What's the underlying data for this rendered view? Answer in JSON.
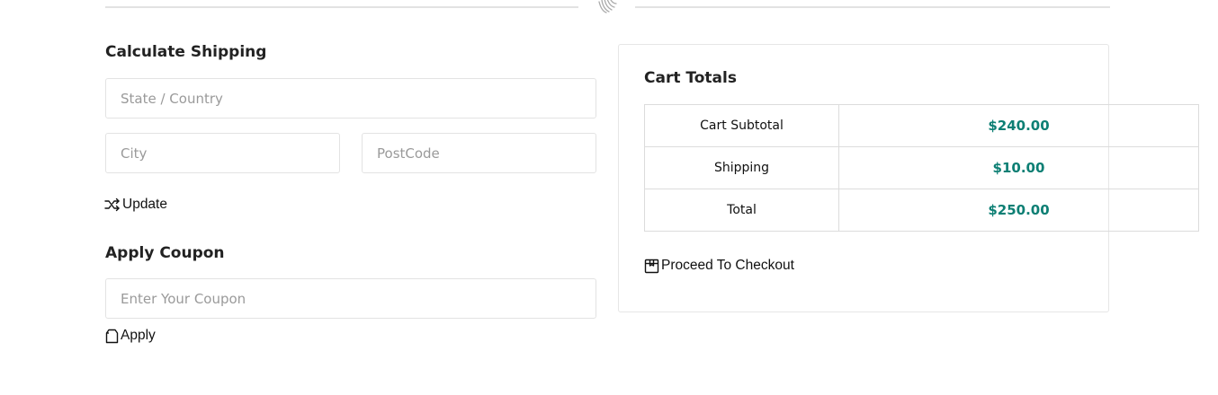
{
  "colors": {
    "accent": "#0d7f74"
  },
  "divider": {
    "icon": "fingerprint-icon"
  },
  "shipping": {
    "heading": "Calculate Shipping",
    "state_placeholder": "State / Country",
    "city_placeholder": "City",
    "postcode_placeholder": "PostCode",
    "update_label": "Update",
    "update_icon": "shuffle-icon"
  },
  "coupon": {
    "heading": "Apply Coupon",
    "placeholder": "Enter Your Coupon",
    "apply_label": "Apply",
    "apply_icon": "bag-icon"
  },
  "cart_totals": {
    "heading": "Cart Totals",
    "rows": [
      {
        "label": "Cart Subtotal",
        "value": "$240.00"
      },
      {
        "label": "Shipping",
        "value": "$10.00"
      },
      {
        "label": "Total",
        "value": "$250.00"
      }
    ],
    "checkout_label": "Proceed To Checkout",
    "checkout_icon": "package-icon"
  }
}
